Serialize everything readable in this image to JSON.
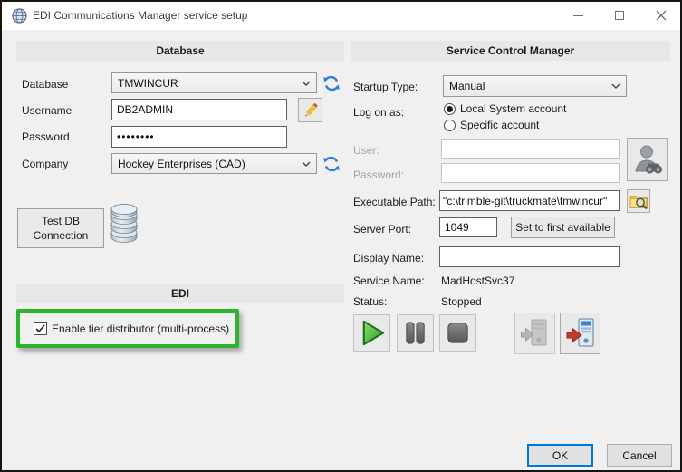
{
  "window": {
    "title": "EDI Communications Manager service setup"
  },
  "database": {
    "header": "Database",
    "database_label": "Database",
    "database_value": "TMWINCUR",
    "username_label": "Username",
    "username_value": "DB2ADMIN",
    "password_label": "Password",
    "password_value": "••••••••",
    "company_label": "Company",
    "company_value": "Hockey Enterprises (CAD)",
    "test_button_label": "Test DB Connection"
  },
  "edi": {
    "header": "EDI",
    "enable_tier_label": "Enable tier distributor (multi-process)",
    "enable_tier_checked": true
  },
  "scm": {
    "header": "Service Control Manager",
    "startup_type_label": "Startup Type:",
    "startup_type_value": "Manual",
    "logon_label": "Log on as:",
    "radio_local_label": "Local System account",
    "radio_local_selected": true,
    "radio_specific_label": "Specific account",
    "radio_specific_selected": false,
    "user_label": "User:",
    "user_value": "",
    "password_label": "Password:",
    "password_value": "",
    "exec_path_label": "Executable Path:",
    "exec_path_value": "\"c:\\trimble-git\\truckmate\\tmwincur\"",
    "server_port_label": "Server Port:",
    "server_port_value": "1049",
    "set_first_button_label": "Set to first available",
    "display_name_label": "Display Name:",
    "display_name_value": "",
    "service_name_label": "Service Name:",
    "service_name_value": "MadHostSvc37",
    "status_label": "Status:",
    "status_value": "Stopped"
  },
  "footer": {
    "ok_label": "OK",
    "cancel_label": "Cancel"
  },
  "icons": {
    "titlebar": "globe-icon",
    "refresh": "refresh-icon",
    "edit": "pencil-icon",
    "database": "database-cylinder-icon",
    "user_lookup": "user-search-icon",
    "browse": "folder-search-icon",
    "start": "play-icon",
    "pause": "pause-icon",
    "stop": "stop-icon",
    "install": "install-service-icon",
    "uninstall": "uninstall-service-icon"
  },
  "colors": {
    "highlight_green": "#2db32d",
    "default_button_border": "#0078d7",
    "refresh_blue": "#2f7cd6",
    "play_green": "#3fae3f",
    "status_red_arrow": "#c23b2e"
  }
}
